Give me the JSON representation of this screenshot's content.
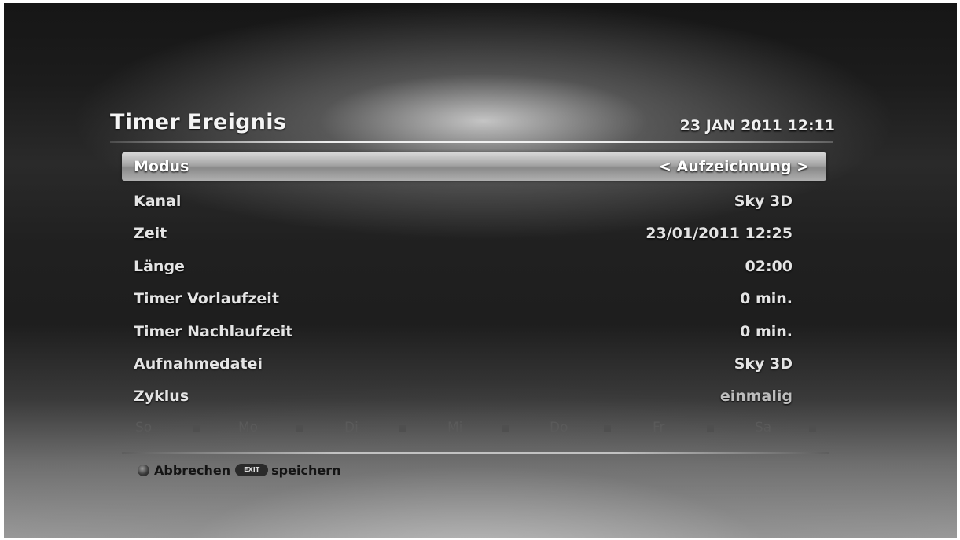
{
  "header": {
    "title": "Timer Ereignis",
    "datetime": "23 JAN 2011 12:11"
  },
  "menu": {
    "items": [
      {
        "label": "Modus",
        "value": "< Aufzeichnung >",
        "selected": true
      },
      {
        "label": "Kanal",
        "value": "Sky 3D"
      },
      {
        "label": "Zeit",
        "value": "23/01/2011 12:25"
      },
      {
        "label": "Länge",
        "value": "02:00"
      },
      {
        "label": "Timer Vorlaufzeit",
        "value": "0 min."
      },
      {
        "label": "Timer Nachlaufzeit",
        "value": "0 min."
      },
      {
        "label": "Aufnahmedatei",
        "value": "Sky 3D"
      },
      {
        "label": "Zyklus",
        "value": "einmalig"
      }
    ]
  },
  "weekdays": [
    "So",
    "Mo",
    "Di",
    "Mi",
    "Do",
    "Fr",
    "Sa"
  ],
  "footer": {
    "cancel_label": "Abbrechen",
    "exit_key": "EXIT",
    "save_label": "speichern"
  },
  "colors": {
    "background": "#1e1e1e",
    "text": "#e4e4e4",
    "selection": "#a4a4a4",
    "disabled": "#5a5a5a"
  }
}
